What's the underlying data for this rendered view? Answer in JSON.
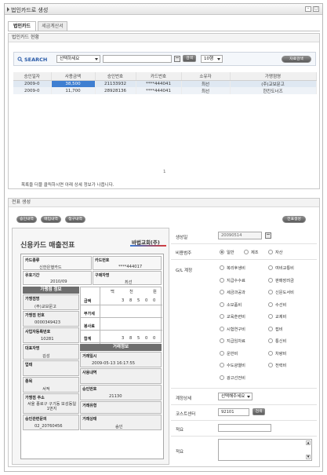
{
  "window": {
    "title": "법인카드로 생성"
  },
  "tabs": [
    {
      "label": "법인카드"
    },
    {
      "label": "세금계산서"
    }
  ],
  "current": {
    "title": "법인카드 현황",
    "search": {
      "label": "SEARCH",
      "select": "선택하세요",
      "search_button": "검색",
      "page_size": "10행",
      "reset_button": "자료검색"
    },
    "columns": [
      "승인일자",
      "사용금액",
      "승인번호",
      "카드번호",
      "소유자",
      "가맹점명"
    ],
    "rows": [
      [
        "2009-0",
        "38,500",
        "21133932",
        "****444041",
        "최선",
        "(주)교보문고"
      ],
      [
        "2009-0",
        "11,700",
        "28928136",
        "****444041",
        "최선",
        "한킨도너즈"
      ]
    ],
    "pager": "1",
    "hint": "목록을 더블 클릭하시면 아래 상세 정보가 나옵니다."
  },
  "slip": {
    "title": "전표 생성",
    "buttons": [
      "승인내역",
      "매입내역",
      "청구내역"
    ],
    "create_button": "전표생성",
    "receipt": {
      "title": "신용카드 매출전표",
      "company": "바법교회(주)",
      "card_company_label": "카드종류",
      "card_company": "신한은행카드",
      "card_no_label": "카드번호",
      "card_no": "****444017",
      "valid_label": "유효기간",
      "valid": "2010/09",
      "buyer_label": "구매자명",
      "buyer": "최선",
      "merchant_header": "가맹점 정보",
      "merchant_name_label": "가맹점명",
      "merchant_name": "(주)교보문고",
      "merchant_no_label": "가맹점 번호",
      "merchant_no": "0000349423",
      "biz_no_label": "사업자등록번호",
      "biz_no": "10281",
      "rep_label": "대표자명",
      "rep": "김성",
      "biz_type_label": "업태",
      "item_label": "종목",
      "item": "서적",
      "address_label": "가맹점 주소",
      "address": "서울 종로구 구기동 보성동일 1번지",
      "inquiry_label": "승인관련문의",
      "inquiry": "02_20760456",
      "amount_labels": [
        "금액",
        "부가세",
        "봉사료",
        "합계"
      ],
      "amount_cols": [
        "백",
        "천",
        "원"
      ],
      "amount_digits": [
        "3",
        "8",
        "5",
        "0",
        "0"
      ],
      "total_digits": [
        "3",
        "8",
        "5",
        "0",
        "0"
      ],
      "trx_header": "거래정보",
      "trx_date_label": "거래일시",
      "trx_date": "2009-05-13   16:17:55",
      "use_label": "사용내역",
      "approval_label": "승인번호",
      "approval": "21130",
      "trx_type_label": "거래유형",
      "trx_status_label": "거래상태",
      "trx_status": "승인"
    },
    "form": {
      "date_label": "생성일",
      "date": "20090514",
      "type_label": "비용범주",
      "types": [
        "일반",
        "제조",
        "자산"
      ],
      "gl_label": "G/L 계정",
      "gl_items": [
        [
          "복리후생비",
          "여비교통비"
        ],
        [
          "지급수수료",
          "판매장려금"
        ],
        [
          "세금과공과",
          "신문도서비"
        ],
        [
          "소모품비",
          "수선비"
        ],
        [
          "교육훈련비",
          "교제비"
        ],
        [
          "시험연구비",
          "접비"
        ],
        [
          "지급임차료",
          "통신비"
        ],
        [
          "운반비",
          "차량비"
        ],
        [
          "수도광열비",
          "전력비"
        ],
        [
          "광고선전비",
          ""
        ]
      ],
      "status_label": "계정상세",
      "status_select": "선택해주세요",
      "cost_label": "코스트센터",
      "cost_value": "92101",
      "cost_button": "검색",
      "summary_label": "적요",
      "memo_label": "적요"
    }
  }
}
